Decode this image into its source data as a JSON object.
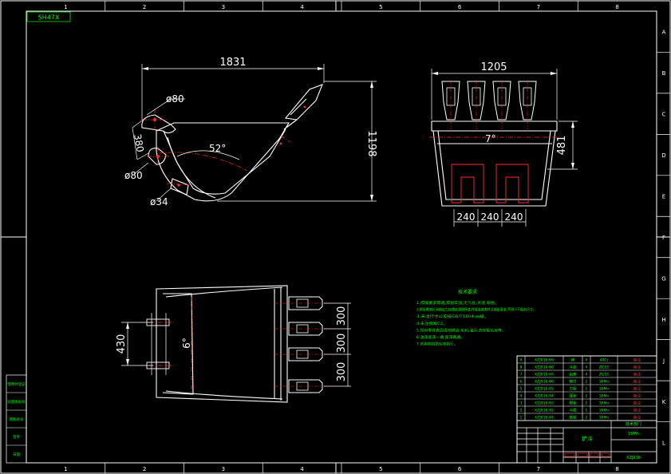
{
  "drawing": {
    "code_label": "SH47X",
    "colors": {
      "background": "#000000",
      "frame": "#ffffff",
      "outline": "#ffffff",
      "dimension": "#ffffff",
      "centerline": "#ff2a2a",
      "notes": "#00ff00",
      "title_text": "#00ff00",
      "title_lines": "#ffffff",
      "title_accent": "#ff2a2a"
    },
    "grid": {
      "columns": [
        "1",
        "2",
        "3",
        "4",
        "5",
        "6",
        "7",
        "8"
      ],
      "rows": [
        "A",
        "B",
        "C",
        "D",
        "E",
        "F",
        "G",
        "H",
        "J",
        "K",
        "L"
      ]
    },
    "side_view": {
      "dims": {
        "length": "1831",
        "height": "1198",
        "pin_dist": "380",
        "angle": "52°"
      },
      "diameters": {
        "top_pin": "ø80",
        "bottom_pin": "ø80",
        "small_pin": "ø34"
      }
    },
    "front_view": {
      "dims": {
        "width": "1205",
        "depth": "481",
        "taper": "7°",
        "spacing": [
          "240",
          "240",
          "240"
        ]
      }
    },
    "top_view": {
      "dims": {
        "pin_width": "430",
        "tooth_spacing": [
          "300",
          "300",
          "300"
        ],
        "angle": "6°"
      }
    },
    "notes": {
      "title": "技术要求",
      "lines": [
        "1.焊缝要求焊透,焊接牢固,无气孔,夹渣,裂纹。",
        "2.焊后需进行消除应力处理并清理焊渣,焊缝高度需符合图纸要求,不得少于图示尺寸。",
        "3.未注尺寸公差按GB/T1804-m级。",
        "4.未注倒角C2。",
        "5.所有零件表面清除锈迹,毛刺,油污,去除氧化皮等。",
        "6.油漆底漆一遍,面漆两遍。",
        "7.其余按相关标准执行。"
      ]
    },
    "parts_table": {
      "rows": [
        [
          "9",
          "XZJ916-09",
          "销",
          "4",
          "40Cr",
          "备注"
        ],
        [
          "8",
          "XZJ916-08",
          "斗齿",
          "4",
          "ZG35",
          "备注"
        ],
        [
          "7",
          "XZJ916-07",
          "齿座",
          "4",
          "ZG35",
          "备注"
        ],
        [
          "6",
          "XZJ916-06",
          "侧刃",
          "2",
          "16Mn",
          "备注"
        ],
        [
          "5",
          "XZJ916-05",
          "刃板",
          "1",
          "16Mn",
          "备注"
        ],
        [
          "4",
          "XZJ916-04",
          "耳板",
          "2",
          "16Mn",
          "备注"
        ],
        [
          "3",
          "XZJ916-03",
          "侧板",
          "2",
          "16Mn",
          "备注"
        ],
        [
          "2",
          "XZJ916-02",
          "斗底",
          "1",
          "16Mn",
          "备注"
        ],
        [
          "1",
          "XZJ916-01",
          "筋板",
          "2",
          "16Mn",
          "备注"
        ]
      ]
    },
    "title_block": {
      "name": "铲斗",
      "material": "16Mn",
      "code": "XZJ916",
      "stamp": "技术部门"
    },
    "left_margin_labels": [
      "借用件登记",
      "旧底图总号",
      "底图总号",
      "签字",
      "日期"
    ]
  }
}
